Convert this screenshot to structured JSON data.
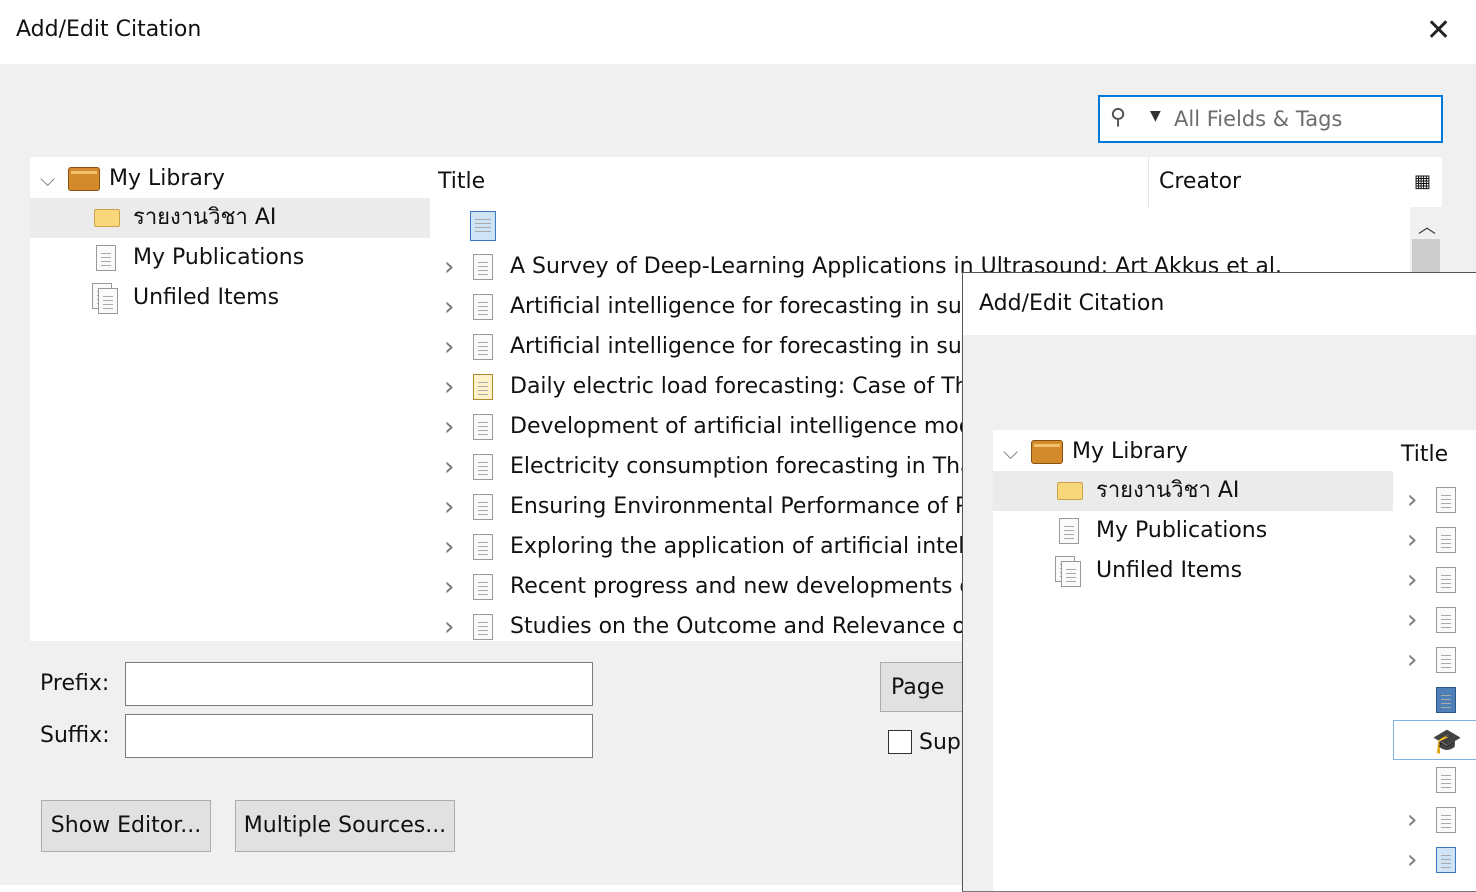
{
  "main": {
    "title": "Add/Edit Citation",
    "search_placeholder": "All Fields & Tags",
    "tree": {
      "library": "My Library",
      "collection": "รายงานวิชา AI",
      "publications": "My Publications",
      "unfiled": "Unfiled Items"
    },
    "columns": {
      "title": "Title",
      "creator": "Creator"
    },
    "items": [
      {
        "title": "",
        "creator": ""
      },
      {
        "title": "A Survey of Deep-Learning Applications in Ultrasound: Arti...",
        "creator": "Akkus et al."
      },
      {
        "title": "Artificial intelligence for forecasting in supp",
        "creator": ""
      },
      {
        "title": "Artificial intelligence for forecasting in supp",
        "creator": ""
      },
      {
        "title": "Daily electric load forecasting: Case of Thai",
        "creator": ""
      },
      {
        "title": "Development of artificial intelligence mode",
        "creator": ""
      },
      {
        "title": "Electricity consumption forecasting in Thai",
        "creator": ""
      },
      {
        "title": "Ensuring Environmental Performance of Ph",
        "creator": ""
      },
      {
        "title": "Exploring the application of artificial intellig",
        "creator": ""
      },
      {
        "title": "Recent progress and new developments of",
        "creator": ""
      },
      {
        "title": "Studies on the Outcome and Relevance of I",
        "creator": ""
      }
    ],
    "prefix_label": "Prefix:",
    "suffix_label": "Suffix:",
    "prefix_value": "",
    "suffix_value": "",
    "locator_select": "Page",
    "suppress_label": "Sup",
    "show_editor": "Show Editor...",
    "multiple_sources": "Multiple Sources..."
  },
  "second": {
    "title": "Add/Edit Citation",
    "tree": {
      "library": "My Library",
      "collection": "รายงานวิชา AI",
      "publications": "My Publications",
      "unfiled": "Unfiled Items"
    },
    "columns": {
      "title": "Title"
    },
    "rows": [
      {
        "icon": "document-icon",
        "expand": true
      },
      {
        "icon": "document-icon",
        "expand": true
      },
      {
        "icon": "document-icon",
        "expand": true
      },
      {
        "icon": "document-icon",
        "expand": true
      },
      {
        "icon": "document-icon",
        "expand": true
      },
      {
        "icon": "book-icon",
        "expand": false
      },
      {
        "icon": "thesis-icon",
        "expand": false
      },
      {
        "icon": "document-icon",
        "expand": false
      },
      {
        "icon": "document-icon",
        "expand": true
      },
      {
        "icon": "web-page-icon",
        "expand": true
      }
    ]
  }
}
